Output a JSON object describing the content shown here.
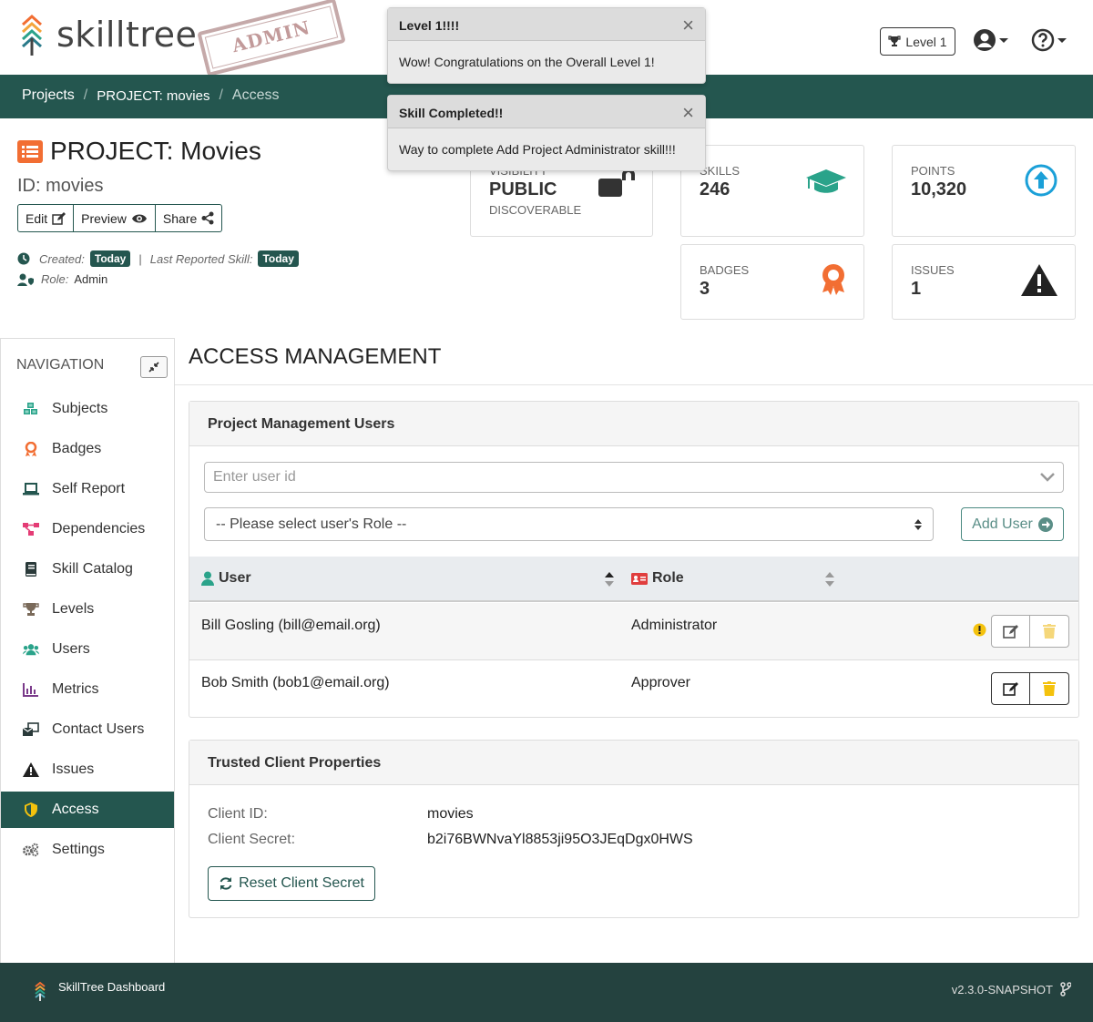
{
  "header": {
    "logo_text": "skilltree",
    "stamp_text": "ADMIN",
    "level_button": "Level 1"
  },
  "breadcrumb": {
    "items": [
      "Projects",
      "PROJECT: movies",
      "Access"
    ]
  },
  "toasts": [
    {
      "title": "Level 1!!!!",
      "body": "Wow! Congratulations on the Overall Level 1!",
      "close": "×"
    },
    {
      "title": "Skill Completed!!",
      "body": "Way to complete Add Project Administrator skill!!!",
      "close": "×"
    }
  ],
  "project": {
    "title": "PROJECT: Movies",
    "id_line": "ID: movies",
    "buttons": {
      "edit": "Edit",
      "preview": "Preview",
      "share": "Share"
    },
    "created_label": "Created:",
    "created_value": "Today",
    "separator": "|",
    "last_reported_label": "Last Reported Skill:",
    "last_reported_value": "Today",
    "role_label": "Role:",
    "role_value": "Admin"
  },
  "stats": {
    "visibility": {
      "label": "VISIBILITY",
      "value": "PUBLIC",
      "sub": "DISCOVERABLE"
    },
    "skills": {
      "label": "SKILLS",
      "value": "246"
    },
    "points": {
      "label": "POINTS",
      "value": "10,320"
    },
    "badges": {
      "label": "BADGES",
      "value": "3"
    },
    "issues": {
      "label": "ISSUES",
      "value": "1"
    }
  },
  "nav": {
    "title": "NAVIGATION",
    "items": [
      {
        "label": "Subjects",
        "icon": "cubes-icon",
        "color": "#2aa38a"
      },
      {
        "label": "Badges",
        "icon": "award-icon",
        "color": "#f26e33"
      },
      {
        "label": "Self Report",
        "icon": "laptop-icon",
        "color": "#24564f"
      },
      {
        "label": "Dependencies",
        "icon": "project-diagram-icon",
        "color": "#e43c75"
      },
      {
        "label": "Skill Catalog",
        "icon": "book-icon",
        "color": "#2a3a3a"
      },
      {
        "label": "Levels",
        "icon": "trophy-icon",
        "color": "#7a6a5a"
      },
      {
        "label": "Users",
        "icon": "users-icon",
        "color": "#2aa38a"
      },
      {
        "label": "Metrics",
        "icon": "chart-bar-icon",
        "color": "#7a3a8a"
      },
      {
        "label": "Contact Users",
        "icon": "mail-bulk-icon",
        "color": "#2a3a3a"
      },
      {
        "label": "Issues",
        "icon": "exclamation-triangle-icon",
        "color": "#222222"
      },
      {
        "label": "Access",
        "icon": "shield-icon",
        "color": "#f4c20d"
      },
      {
        "label": "Settings",
        "icon": "cogs-icon",
        "color": "#666666"
      }
    ],
    "active_index": 10
  },
  "main": {
    "title": "ACCESS MANAGEMENT",
    "users_panel": {
      "title": "Project Management Users",
      "user_placeholder": "Enter user id",
      "role_placeholder": "-- Please select user's Role --",
      "add_button": "Add User",
      "columns": [
        "User",
        "Role"
      ],
      "rows": [
        {
          "user": "Bill Gosling (bill@email.org)",
          "role": "Administrator",
          "warning": true
        },
        {
          "user": "Bob Smith (bob1@email.org)",
          "role": "Approver",
          "warning": false
        }
      ]
    },
    "trusted_panel": {
      "title": "Trusted Client Properties",
      "client_id_label": "Client ID:",
      "client_id": "movies",
      "client_secret_label": "Client Secret:",
      "client_secret": "b2i76BWNvaYl8853ji95O3JEqDgx0HWS",
      "reset_button": "Reset Client Secret"
    }
  },
  "footer": {
    "app_name": "SkillTree Dashboard",
    "version": "v2.3.0-SNAPSHOT"
  },
  "colors": {
    "primary": "#24564f",
    "accent_orange": "#f26e33",
    "footer_bg": "#24423f"
  }
}
